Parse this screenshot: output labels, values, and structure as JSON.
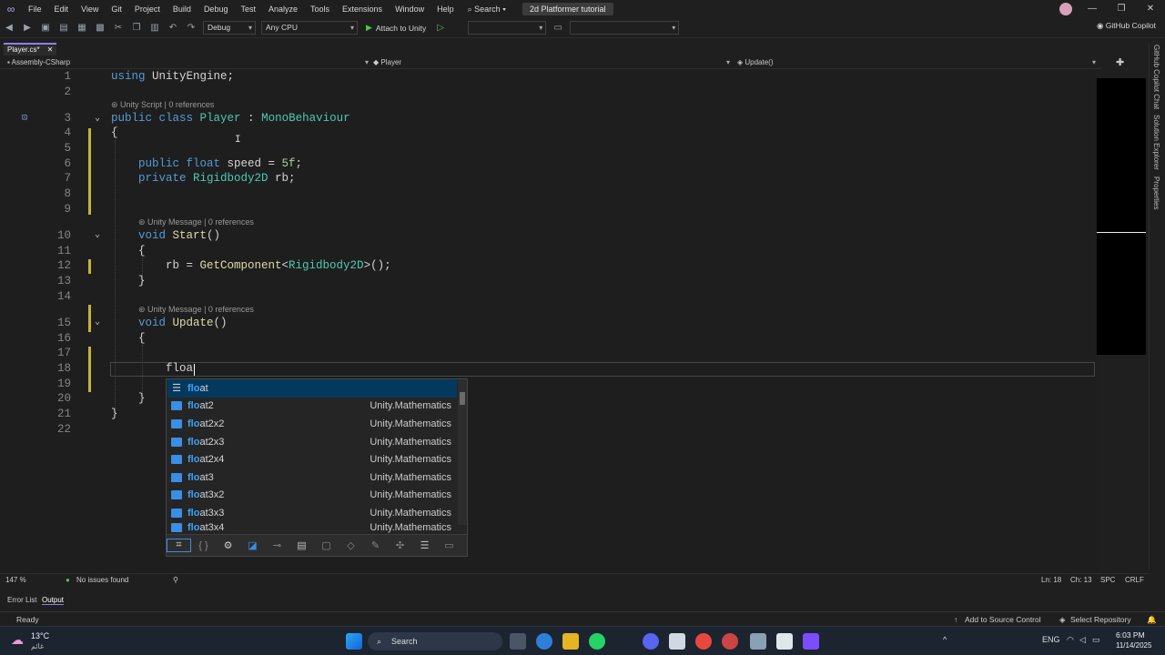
{
  "menubar": {
    "items": [
      "File",
      "Edit",
      "View",
      "Git",
      "Project",
      "Build",
      "Debug",
      "Test",
      "Analyze",
      "Tools",
      "Extensions",
      "Window",
      "Help"
    ],
    "search": "Search",
    "solution_title": "2d Platformer tutorial"
  },
  "toolbar": {
    "config": "Debug",
    "platform": "Any CPU",
    "attach": "Attach to Unity",
    "copilot": "GitHub Copilot"
  },
  "tab": {
    "label": "Player.cs*",
    "close": "✕"
  },
  "navbar": {
    "project": "Assembly-CSharp",
    "class": "Player",
    "member": "Update()"
  },
  "editor": {
    "line_numbers": [
      "1",
      "2",
      "3",
      "4",
      "5",
      "6",
      "7",
      "8",
      "9",
      "10",
      "11",
      "12",
      "13",
      "14",
      "15",
      "16",
      "17",
      "18",
      "19",
      "20",
      "21",
      "22"
    ],
    "lens": {
      "class": "Unity Script | 0 references",
      "start": "Unity Message | 0 references",
      "update": "Unity Message | 0 references"
    },
    "typed_text": "floa"
  },
  "completion": {
    "items": [
      {
        "match": "flo",
        "rest": "at",
        "ns": "",
        "kind": "keyword"
      },
      {
        "match": "flo",
        "rest": "at2",
        "ns": "Unity.Mathematics",
        "kind": "struct"
      },
      {
        "match": "flo",
        "rest": "at2x2",
        "ns": "Unity.Mathematics",
        "kind": "struct"
      },
      {
        "match": "flo",
        "rest": "at2x3",
        "ns": "Unity.Mathematics",
        "kind": "struct"
      },
      {
        "match": "flo",
        "rest": "at2x4",
        "ns": "Unity.Mathematics",
        "kind": "struct"
      },
      {
        "match": "flo",
        "rest": "at3",
        "ns": "Unity.Mathematics",
        "kind": "struct"
      },
      {
        "match": "flo",
        "rest": "at3x2",
        "ns": "Unity.Mathematics",
        "kind": "struct"
      },
      {
        "match": "flo",
        "rest": "at3x3",
        "ns": "Unity.Mathematics",
        "kind": "struct"
      },
      {
        "match": "flo",
        "rest": "at3x4",
        "ns": "Unity.Mathematics",
        "kind": "struct"
      }
    ]
  },
  "right_rail": {
    "copilot_chat": "GitHub Copilot Chat",
    "solution_explorer": "Solution Explorer",
    "properties": "Properties"
  },
  "status_line": {
    "zoom": "147 %",
    "issues": "No issues found",
    "ln": "Ln: 18",
    "ch": "Ch: 13",
    "spc": "SPC",
    "crlf": "CRLF"
  },
  "panel_tabs": {
    "error_list": "Error List",
    "output": "Output"
  },
  "status_bar": {
    "ready": "Ready",
    "source_control": "Add to Source Control",
    "repo": "Select Repository"
  },
  "taskbar": {
    "weather_temp": "13°C",
    "weather_desc": "غائم",
    "search": "Search",
    "lang": "ENG",
    "time": "6:03 PM",
    "date": "11/14/2025"
  },
  "colors": {
    "accent": "#8e7ee8",
    "keyword": "#569cd6",
    "type": "#4ec9b0",
    "match": "#3fa2f7"
  }
}
